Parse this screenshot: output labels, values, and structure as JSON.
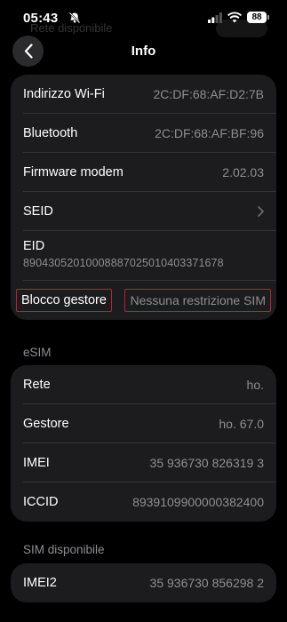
{
  "status_bar": {
    "time": "05:43",
    "battery": "88"
  },
  "ghost_header": {
    "text": "Rete disponibile"
  },
  "nav": {
    "title": "Info"
  },
  "info_group": {
    "wifi": {
      "label": "Indirizzo Wi-Fi",
      "value": "2C:DF:68:AF:D2:7B"
    },
    "bluetooth": {
      "label": "Bluetooth",
      "value": "2C:DF:68:AF:BF:96"
    },
    "firmware": {
      "label": "Firmware modem",
      "value": "2.02.03"
    },
    "seid": {
      "label": "SEID"
    },
    "eid": {
      "label": "EID",
      "value": "89043052010008887025010403371678"
    },
    "carrier_lock": {
      "label": "Blocco gestore",
      "value": "Nessuna restrizione SIM"
    }
  },
  "esim": {
    "header": "eSIM",
    "network": {
      "label": "Rete",
      "value": "ho."
    },
    "carrier": {
      "label": "Gestore",
      "value": "ho. 67.0"
    },
    "imei": {
      "label": "IMEI",
      "value": "35 936730 826319 3"
    },
    "iccid": {
      "label": "ICCID",
      "value": "8939109900000382400"
    }
  },
  "sim_available": {
    "header": "SIM disponibile",
    "imei2": {
      "label": "IMEI2",
      "value": "35 936730 856298 2"
    }
  },
  "colors": {
    "background": "#000000",
    "group_bg": "#1c1c1e",
    "value_text": "#8e8e93",
    "highlight_border": "#b3263a"
  }
}
